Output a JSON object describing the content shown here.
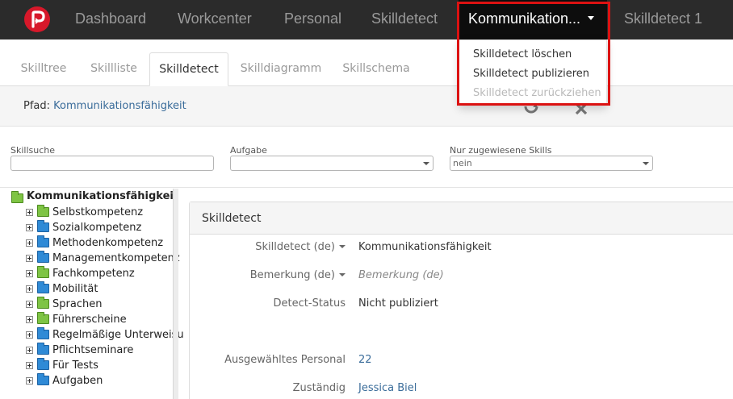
{
  "navbar": {
    "items": [
      "Dashboard",
      "Workcenter",
      "Personal",
      "Skilldetect",
      "Kommunikation...",
      "Skilldetect 1"
    ],
    "active_index": 4
  },
  "dropdown": {
    "items": [
      {
        "label": "Skilldetect löschen",
        "enabled": true
      },
      {
        "label": "Skilldetect publizieren",
        "enabled": true
      },
      {
        "label": "Skilldetect zurückziehen",
        "enabled": false
      }
    ]
  },
  "tabs": [
    "Skilltree",
    "Skillliste",
    "Skilldetect",
    "Skilldiagramm",
    "Skillschema"
  ],
  "active_tab": "Skilldetect",
  "path": {
    "label": "Pfad:",
    "value": "Kommunikationsfähigkeit"
  },
  "icons": {
    "refresh": "refresh-icon",
    "close": "close-icon"
  },
  "filters": {
    "skillsuche": {
      "label": "Skillsuche",
      "value": ""
    },
    "aufgabe": {
      "label": "Aufgabe",
      "value": ""
    },
    "zugewiesen": {
      "label": "Nur zugewiesene Skills",
      "value": "nein"
    }
  },
  "tree": {
    "root": "Kommunikationsfähigkeit",
    "items": [
      {
        "label": "Selbstkompetenz",
        "color": "green"
      },
      {
        "label": "Sozialkompetenz",
        "color": "blue"
      },
      {
        "label": "Methodenkompetenz",
        "color": "blue"
      },
      {
        "label": "Managementkompetenz",
        "color": "blue"
      },
      {
        "label": "Fachkompetenz",
        "color": "green"
      },
      {
        "label": "Mobilität",
        "color": "blue"
      },
      {
        "label": "Sprachen",
        "color": "green"
      },
      {
        "label": "Führerscheine",
        "color": "green"
      },
      {
        "label": "Regelmäßige Unterweisu",
        "color": "blue"
      },
      {
        "label": "Pflichtseminare",
        "color": "blue"
      },
      {
        "label": "Für Tests",
        "color": "blue"
      },
      {
        "label": "Aufgaben",
        "color": "blue"
      }
    ]
  },
  "panel": {
    "title": "Skilldetect",
    "rows": [
      {
        "label": "Skilldetect (de)",
        "value": "Kommunikationsfähigkeit",
        "dropdown": true
      },
      {
        "label": "Bemerkung (de)",
        "value": "Bemerkung (de)",
        "dropdown": true
      },
      {
        "label": "Detect-Status",
        "value": "Nicht publiziert",
        "dropdown": false
      },
      {
        "label": "Ausgewähltes Personal",
        "value": "22",
        "dropdown": false
      },
      {
        "label": "Zuständig",
        "value": "Jessica Biel",
        "dropdown": false
      }
    ]
  },
  "colors": {
    "navbar": "#2b2b2b",
    "accent_red": "#dc1212",
    "link": "#3a6c9a",
    "folder_green": "#7ec444",
    "folder_blue": "#2f8ad6"
  }
}
